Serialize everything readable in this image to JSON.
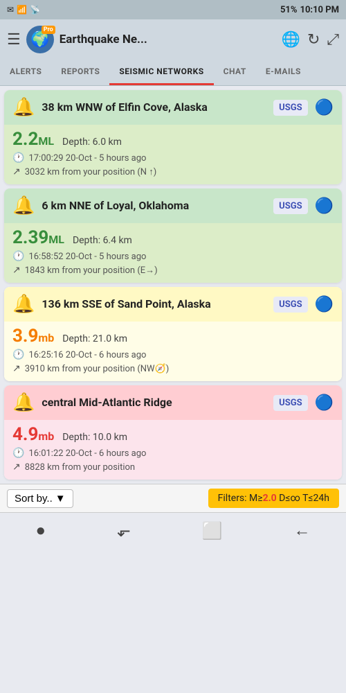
{
  "statusBar": {
    "left": [
      "✉",
      "☰",
      "📶"
    ],
    "signal": "📶",
    "battery": "51%",
    "time": "10:10 PM"
  },
  "header": {
    "title": "Earthquake Ne...",
    "menuIcon": "☰",
    "globeIcon": "🌐",
    "refreshIcon": "↻",
    "expandIcon": "⤢"
  },
  "tabs": [
    {
      "label": "ALERTS",
      "active": false
    },
    {
      "label": "REPORTS",
      "active": false
    },
    {
      "label": "SEISMIC NETWORKS",
      "active": true
    },
    {
      "label": "CHAT",
      "active": false
    },
    {
      "label": "E-MAILS",
      "active": false
    }
  ],
  "earthquakes": [
    {
      "id": "eq1",
      "icon": "🔔",
      "location": "38 km WNW of Elfin Cove, Alaska",
      "source": "USGS",
      "magnitude": "2.2",
      "magType": "ML",
      "magColor": "green",
      "depth": "Depth: 6.0 km",
      "time": "17:00:29 20-Oct - 5 hours ago",
      "distance": "3032 km from your position (N ↑)",
      "cardColor": "green"
    },
    {
      "id": "eq2",
      "icon": "🔔",
      "location": "6 km NNE of Loyal, Oklahoma",
      "source": "USGS",
      "magnitude": "2.39",
      "magType": "ML",
      "magColor": "green",
      "depth": "Depth: 6.4 km",
      "time": "16:58:52 20-Oct - 5 hours ago",
      "distance": "1843 km from your position (E→)",
      "cardColor": "green"
    },
    {
      "id": "eq3",
      "icon": "🔔",
      "location": "136 km SSE of Sand Point, Alaska",
      "source": "USGS",
      "magnitude": "3.9",
      "magType": "mb",
      "magColor": "orange",
      "depth": "Depth: 21.0 km",
      "time": "16:25:16 20-Oct - 6 hours ago",
      "distance": "3910 km from your position (NW🧭)",
      "cardColor": "yellow"
    },
    {
      "id": "eq4",
      "icon": "🔔",
      "location": "central Mid-Atlantic Ridge",
      "source": "USGS",
      "magnitude": "4.9",
      "magType": "mb",
      "magColor": "red",
      "depth": "Depth: 10.0 km",
      "time": "16:01:22 20-Oct - 6 hours ago",
      "distance": "8828 km from your position",
      "cardColor": "pink"
    }
  ],
  "bottomBar": {
    "sortLabel": "Sort by..",
    "filterText": "Filters: M≥",
    "filterMag": "2.0",
    "filterDepth": "D≤∞",
    "filterTime": "T≤24h"
  },
  "navBar": {
    "icons": [
      "●",
      "⬛",
      "■",
      "←"
    ]
  }
}
